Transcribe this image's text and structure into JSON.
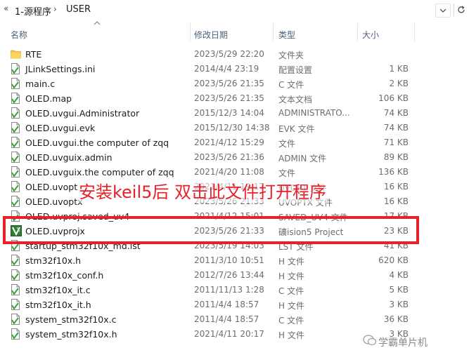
{
  "address_bar": {
    "breadcrumbs": [
      "1-源程序",
      "USER"
    ]
  },
  "columns": {
    "name": "名称",
    "date": "修改日期",
    "type": "类型",
    "size": "大小"
  },
  "files": [
    {
      "name": "RTE",
      "date": "2023/5/29 22:20",
      "type": "文件夹",
      "size": "",
      "icon": "folder-icon"
    },
    {
      "name": "JLinkSettings.ini",
      "date": "2014/4/4 23:19",
      "type": "配置设置",
      "size": "1 KB",
      "icon": "config-file-icon"
    },
    {
      "name": "main.c",
      "date": "2023/5/26 21:35",
      "type": "C 文件",
      "size": "2 KB",
      "icon": "c-file-icon"
    },
    {
      "name": "OLED.map",
      "date": "2023/5/26 21:35",
      "type": "文本文档",
      "size": "106 KB",
      "icon": "text-file-icon"
    },
    {
      "name": "OLED.uvgui.Administrator",
      "date": "2015/12/3 14:04",
      "type": "ADMINISTRATO...",
      "size": "74 KB",
      "icon": "file-icon"
    },
    {
      "name": "OLED.uvgui.evk",
      "date": "2015/12/30 14:38",
      "type": "EVK 文件",
      "size": "74 KB",
      "icon": "file-icon"
    },
    {
      "name": "OLED.uvgui.the computer of zqq",
      "date": "2021/4/12 15:29",
      "type": "文件",
      "size": "71 KB",
      "icon": "file-icon"
    },
    {
      "name": "OLED.uvguix.admin",
      "date": "2023/5/26 21:36",
      "type": "ADMIN 文件",
      "size": "89 KB",
      "icon": "file-icon"
    },
    {
      "name": "OLED.uvguix.the computer of zqq",
      "date": "2021/4/20 11:08",
      "type": "文件",
      "size": "136 KB",
      "icon": "file-icon"
    },
    {
      "name": "OLED.uvopt",
      "date": "2021/4/11 19:17",
      "type": "UVOPT 文件",
      "size": "16 KB",
      "icon": "file-icon"
    },
    {
      "name": "OLED.uvoptx",
      "date": "2023/5/26 21:33",
      "type": "UVOPTX 文件",
      "size": "16 KB",
      "icon": "file-icon"
    },
    {
      "name": "OLED.uvproj.saved_uv4",
      "date": "2021/4/12 15:01",
      "type": "SAVED_UV4 文件",
      "size": "17 KB",
      "icon": "file-icon"
    },
    {
      "name": "OLED.uvprojx",
      "date": "2023/5/26 21:33",
      "type": "礦ision5 Project",
      "size": "23 KB",
      "icon": "keil-project-icon"
    },
    {
      "name": "startup_stm32f10x_md.lst",
      "date": "2023/5/19 14:03",
      "type": "LST 文件",
      "size": "41 KB",
      "icon": "file-icon"
    },
    {
      "name": "stm32f10x.h",
      "date": "2011/3/10 10:51",
      "type": "H 文件",
      "size": "620 KB",
      "icon": "h-file-icon"
    },
    {
      "name": "stm32f10x_conf.h",
      "date": "2012/7/26 13:44",
      "type": "H 文件",
      "size": "4 KB",
      "icon": "h-file-icon"
    },
    {
      "name": "stm32f10x_it.c",
      "date": "2011/11/13 1:28",
      "type": "C 文件",
      "size": "5 KB",
      "icon": "c-file-icon"
    },
    {
      "name": "stm32f10x_it.h",
      "date": "2011/4/4 18:57",
      "type": "H 文件",
      "size": "3 KB",
      "icon": "h-file-icon"
    },
    {
      "name": "system_stm32f10x.c",
      "date": "2011/4/4 18:57",
      "type": "C 文件",
      "size": "36 KB",
      "icon": "c-file-icon"
    },
    {
      "name": "system_stm32f10x.h",
      "date": "2021/4/11 20:17",
      "type": "H 文件",
      "size": "3 KB",
      "icon": "h-file-icon"
    }
  ],
  "annotation": "安装keil5后 双击此文件打开程序",
  "watermark": "学霸单片机",
  "colors": {
    "annotation_red": "#e8202a",
    "header_text": "#4c607a",
    "folder_yellow": "#f5c342",
    "keil_green": "#3a8a3a"
  }
}
